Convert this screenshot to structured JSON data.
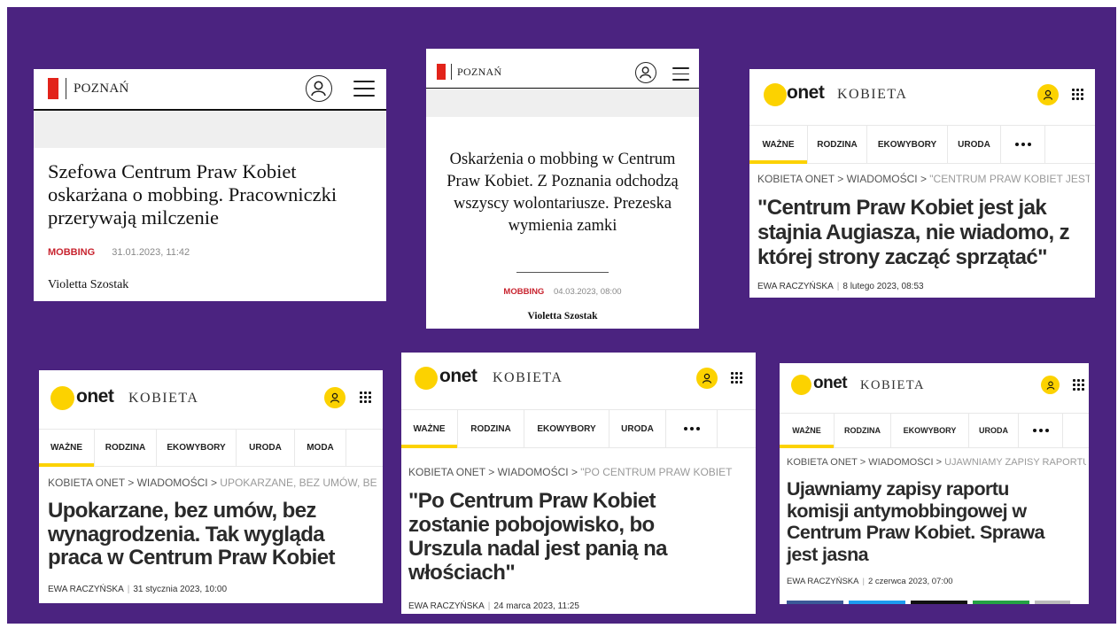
{
  "colors": {
    "background": "#4b2380",
    "poznan_red": "#e2231a",
    "poznan_tag": "#c8242f",
    "onet_yellow": "#fcd200"
  },
  "poznan_1": {
    "city": "POZNAŃ",
    "icons": [
      "user-circle-icon",
      "menu-icon"
    ],
    "title": "Szefowa Centrum Praw Kobiet oskarżana o mobbing. Pracowniczki przerywają milczenie",
    "tag": "MOBBING",
    "date": "31.01.2023, 11:42",
    "author": "Violetta Szostak"
  },
  "poznan_2": {
    "city": "POZNAŃ",
    "icons": [
      "user-circle-icon",
      "menu-icon"
    ],
    "title": "Oskarżenia o mobbing w Centrum Praw Kobiet. Z Poznania odchodzą wszyscy wolontariusze. Prezeska wymienia zamki",
    "tag": "MOBBING",
    "date": "04.03.2023, 08:00",
    "author": "Violetta Szostak"
  },
  "onet_1": {
    "brand": "onet",
    "section": "KOBIETA",
    "tabs": [
      "WAŻNE",
      "RODZINA",
      "EKOWYBORY",
      "URODA"
    ],
    "crumb_1": "KOBIETA ONET",
    "crumb_2": "WIADOMOŚCI",
    "crumb_3": "\"CENTRUM PRAW KOBIET JEST",
    "title": "\"Centrum Praw Kobiet jest jak stajnia Augiasza, nie wiadomo, z której strony zacząć sprzątać\"",
    "author": "EWA RACZYŃSKA",
    "date": "8 lutego 2023, 08:53"
  },
  "onet_2": {
    "brand": "onet",
    "section": "KOBIETA",
    "tabs": [
      "WAŻNE",
      "RODZINA",
      "EKOWYBORY",
      "URODA",
      "MODA"
    ],
    "crumb_1": "KOBIETA ONET",
    "crumb_2": "WIADOMOŚCI",
    "crumb_3": "UPOKARZANE, BEZ UMÓW, BE",
    "title": "Upokarzane, bez umów, bez wynagrodzenia. Tak wygląda praca w Centrum Praw Kobiet",
    "author": "EWA RACZYŃSKA",
    "date": "31 stycznia 2023, 10:00"
  },
  "onet_3": {
    "brand": "onet",
    "section": "KOBIETA",
    "tabs": [
      "WAŻNE",
      "RODZINA",
      "EKOWYBORY",
      "URODA"
    ],
    "crumb_1": "KOBIETA ONET",
    "crumb_2": "WIADOMOŚCI",
    "crumb_3": "\"PO CENTRUM PRAW KOBIET",
    "title": "\"Po Centrum Praw Kobiet zostanie pobojowisko, bo Urszula nadal jest panią na włościach\"",
    "author": "EWA RACZYŃSKA",
    "date": "24 marca 2023, 11:25"
  },
  "onet_4": {
    "brand": "onet",
    "section": "KOBIETA",
    "tabs": [
      "WAŻNE",
      "RODZINA",
      "EKOWYBORY",
      "URODA"
    ],
    "crumb_1": "KOBIETA ONET",
    "crumb_2": "WIADOMOŚCI",
    "crumb_3": "UJAWNIAMY ZAPISY RAPORTU",
    "title": "Ujawniamy zapisy raportu komisji antymobbingowej w Centrum Praw Kobiet. Sprawa jest jasna",
    "author": "EWA RACZYŃSKA",
    "date": "2 czerwca 2023, 07:00"
  }
}
